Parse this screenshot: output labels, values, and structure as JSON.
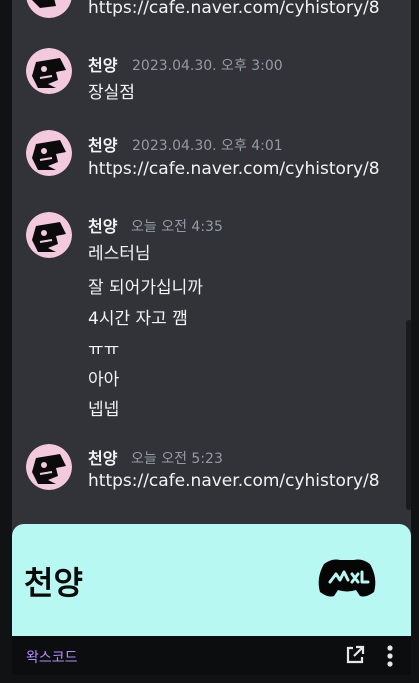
{
  "messages": [
    {
      "author": "",
      "timestamp": "",
      "lines": [
        "https://cafe.naver.com/cyhistory/8"
      ]
    },
    {
      "author": "천양",
      "timestamp": "2023.04.30. 오후 3:00",
      "lines": [
        "장실점"
      ]
    },
    {
      "author": "천양",
      "timestamp": "2023.04.30. 오후 4:01",
      "lines": [
        "https://cafe.naver.com/cyhistory/8"
      ]
    },
    {
      "author": "천양",
      "timestamp": "오늘 오전 4:35",
      "lines": [
        "레스터님",
        "잘 되어가십니까",
        "4시간 자고 깸",
        "ㅠㅠ",
        "아아",
        "넵넵"
      ]
    },
    {
      "author": "천양",
      "timestamp": "오늘 오전 5:23",
      "lines": [
        "https://cafe.naver.com/cyhistory/8"
      ]
    }
  ],
  "card": {
    "title": "천양",
    "logo_icon": "waxcord-logo-icon",
    "background": "#b7f8f2"
  },
  "footer": {
    "label": "왁스코드",
    "accent": "#b58bff",
    "open_icon": "external-link-icon",
    "more_icon": "more-vertical-icon"
  }
}
